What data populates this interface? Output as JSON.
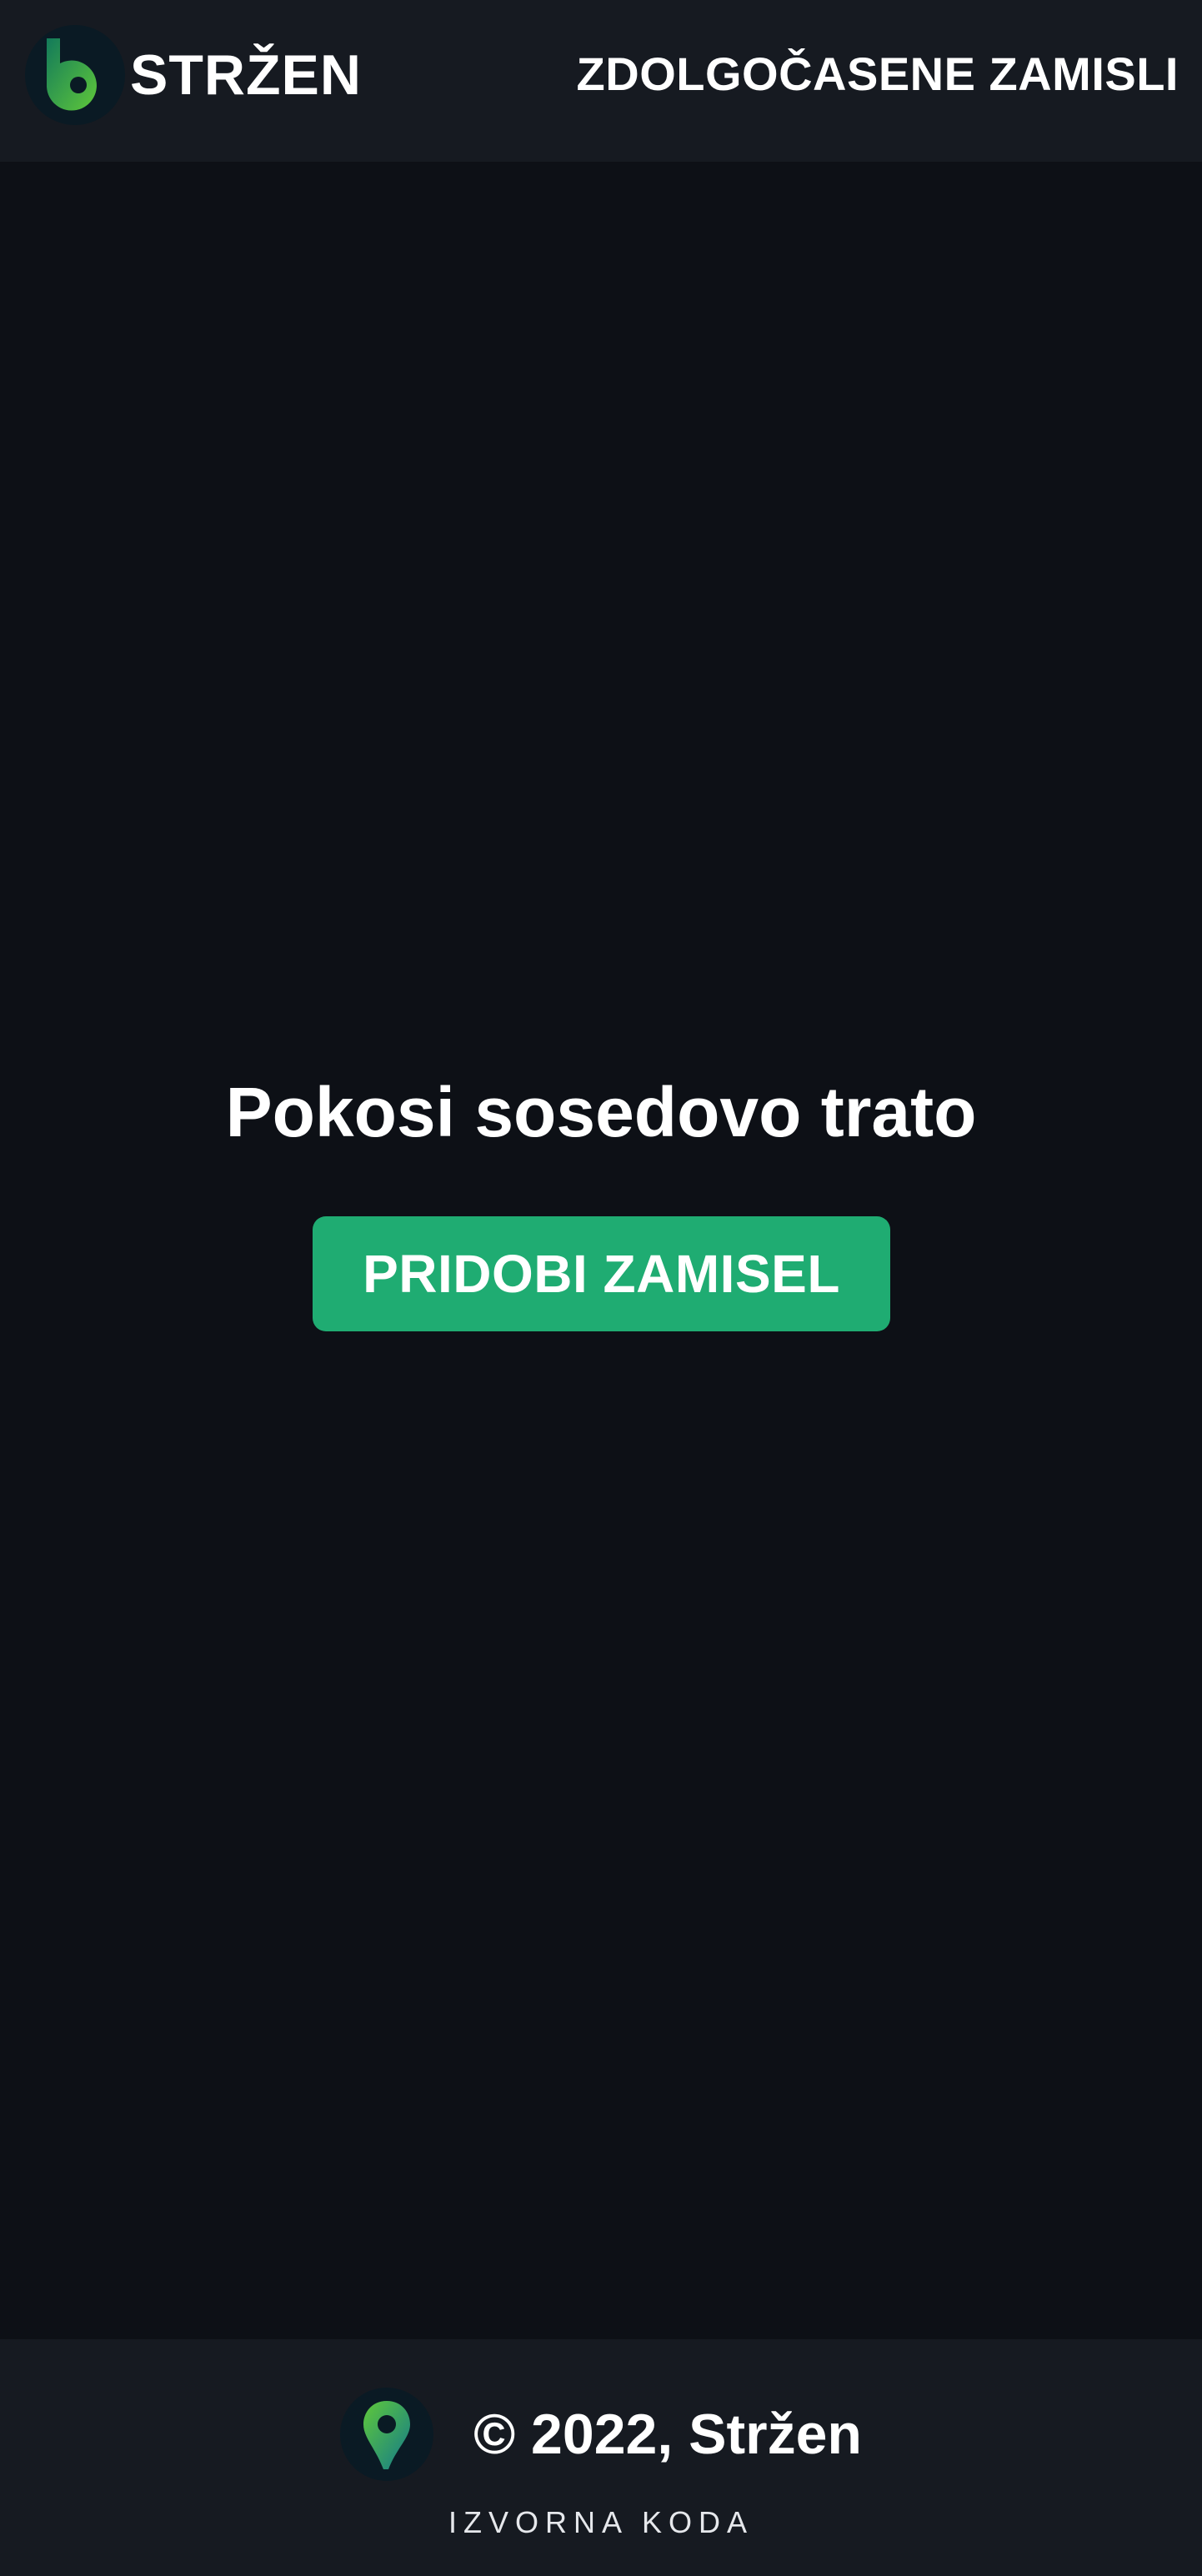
{
  "header": {
    "brand_name": "STRŽEN",
    "nav_link": "ZDOLGOČASENE ZAMISLI"
  },
  "main": {
    "idea_title": "Pokosi sosedovo trato",
    "cta_label": "PRIDOBI ZAMISEL"
  },
  "footer": {
    "copyright": "© 2022, Stržen",
    "source_link": "IZVORNA KODA"
  },
  "icons": {
    "brand_logo": "b-letter-logo-icon",
    "footer_logo": "map-pin-logo-icon"
  },
  "colors": {
    "background": "#0d1016",
    "bar_background": "#161a21",
    "accent": "#1fac72",
    "text": "#ffffff"
  }
}
